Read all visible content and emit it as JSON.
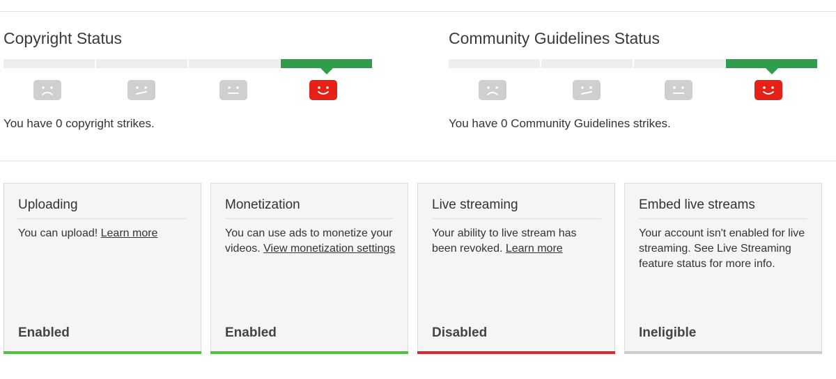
{
  "copyright": {
    "title": "Copyright Status",
    "message": "You have 0 copyright strikes.",
    "active_level": 3
  },
  "community": {
    "title": "Community Guidelines Status",
    "message": "You have 0 Community Guidelines strikes.",
    "active_level": 3
  },
  "faces": [
    "sad-face-icon",
    "meh-face-icon",
    "neutral-face-icon",
    "happy-face-icon"
  ],
  "colors": {
    "meter_active": "#2f9e4b",
    "meter_inactive": "#eeeeee",
    "face_inactive": "#cfcfcf",
    "face_active": "#e62117",
    "enabled": "#4cc53f",
    "disabled": "#e0272a",
    "ineligible": "#cccccc"
  },
  "cards": [
    {
      "title": "Uploading",
      "text": "You can upload! ",
      "link": "Learn more",
      "after": "",
      "status": "Enabled",
      "status_color": "#4cc53f"
    },
    {
      "title": "Monetization",
      "text": "You can use ads to monetize your videos. ",
      "link": "View monetization settings",
      "after": "",
      "status": "Enabled",
      "status_color": "#4cc53f"
    },
    {
      "title": "Live streaming",
      "text": "Your ability to live stream has been revoked. ",
      "link": "Learn more",
      "after": "",
      "status": "Disabled",
      "status_color": "#e0272a"
    },
    {
      "title": "Embed live streams",
      "text": "Your account isn't enabled for live streaming. See Live Streaming feature status for more info.",
      "link": "",
      "after": "",
      "status": "Ineligible",
      "status_color": "#cccccc"
    }
  ]
}
